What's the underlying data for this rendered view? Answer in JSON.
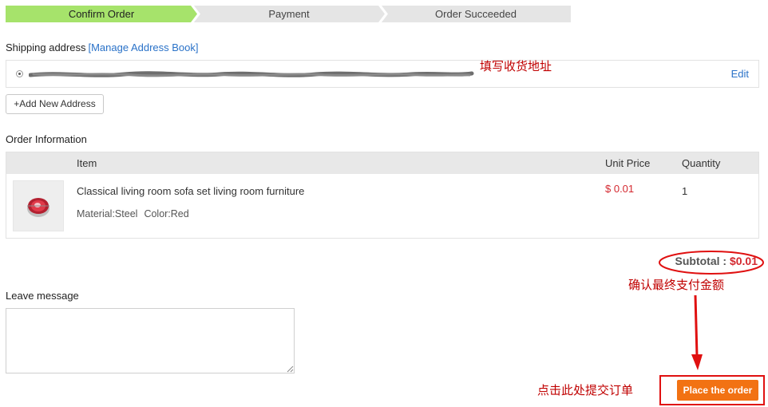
{
  "steps": [
    {
      "label": "Confirm Order",
      "active": true
    },
    {
      "label": "Payment",
      "active": false
    },
    {
      "label": "Order Succeeded",
      "active": false
    }
  ],
  "shipping": {
    "label": "Shipping address",
    "manage_link": "[Manage Address Book]",
    "edit_link": "Edit",
    "add_button": "+Add New Address"
  },
  "annotations": {
    "fill_address": "填写收货地址",
    "confirm_amount": "确认最终支付金额",
    "click_submit": "点击此处提交订单"
  },
  "order": {
    "title": "Order Information",
    "columns": {
      "item": "Item",
      "unit_price": "Unit Price",
      "quantity": "Quantity"
    },
    "product": {
      "name": "Classical living room sofa set living room furniture",
      "material": "Material:Steel",
      "color": "Color:Red",
      "price": "$ 0.01",
      "quantity": "1"
    }
  },
  "subtotal": {
    "label": "Subtotal :",
    "amount": "$0.01"
  },
  "leave_message": {
    "label": "Leave message"
  },
  "place_order": {
    "label": "Place the order"
  },
  "colors": {
    "step_active": "#a6e36b",
    "step_inactive": "#e5e5e5",
    "link": "#2a72c8",
    "price": "#d4282f",
    "annotation": "#c00000",
    "button": "#f27213"
  }
}
